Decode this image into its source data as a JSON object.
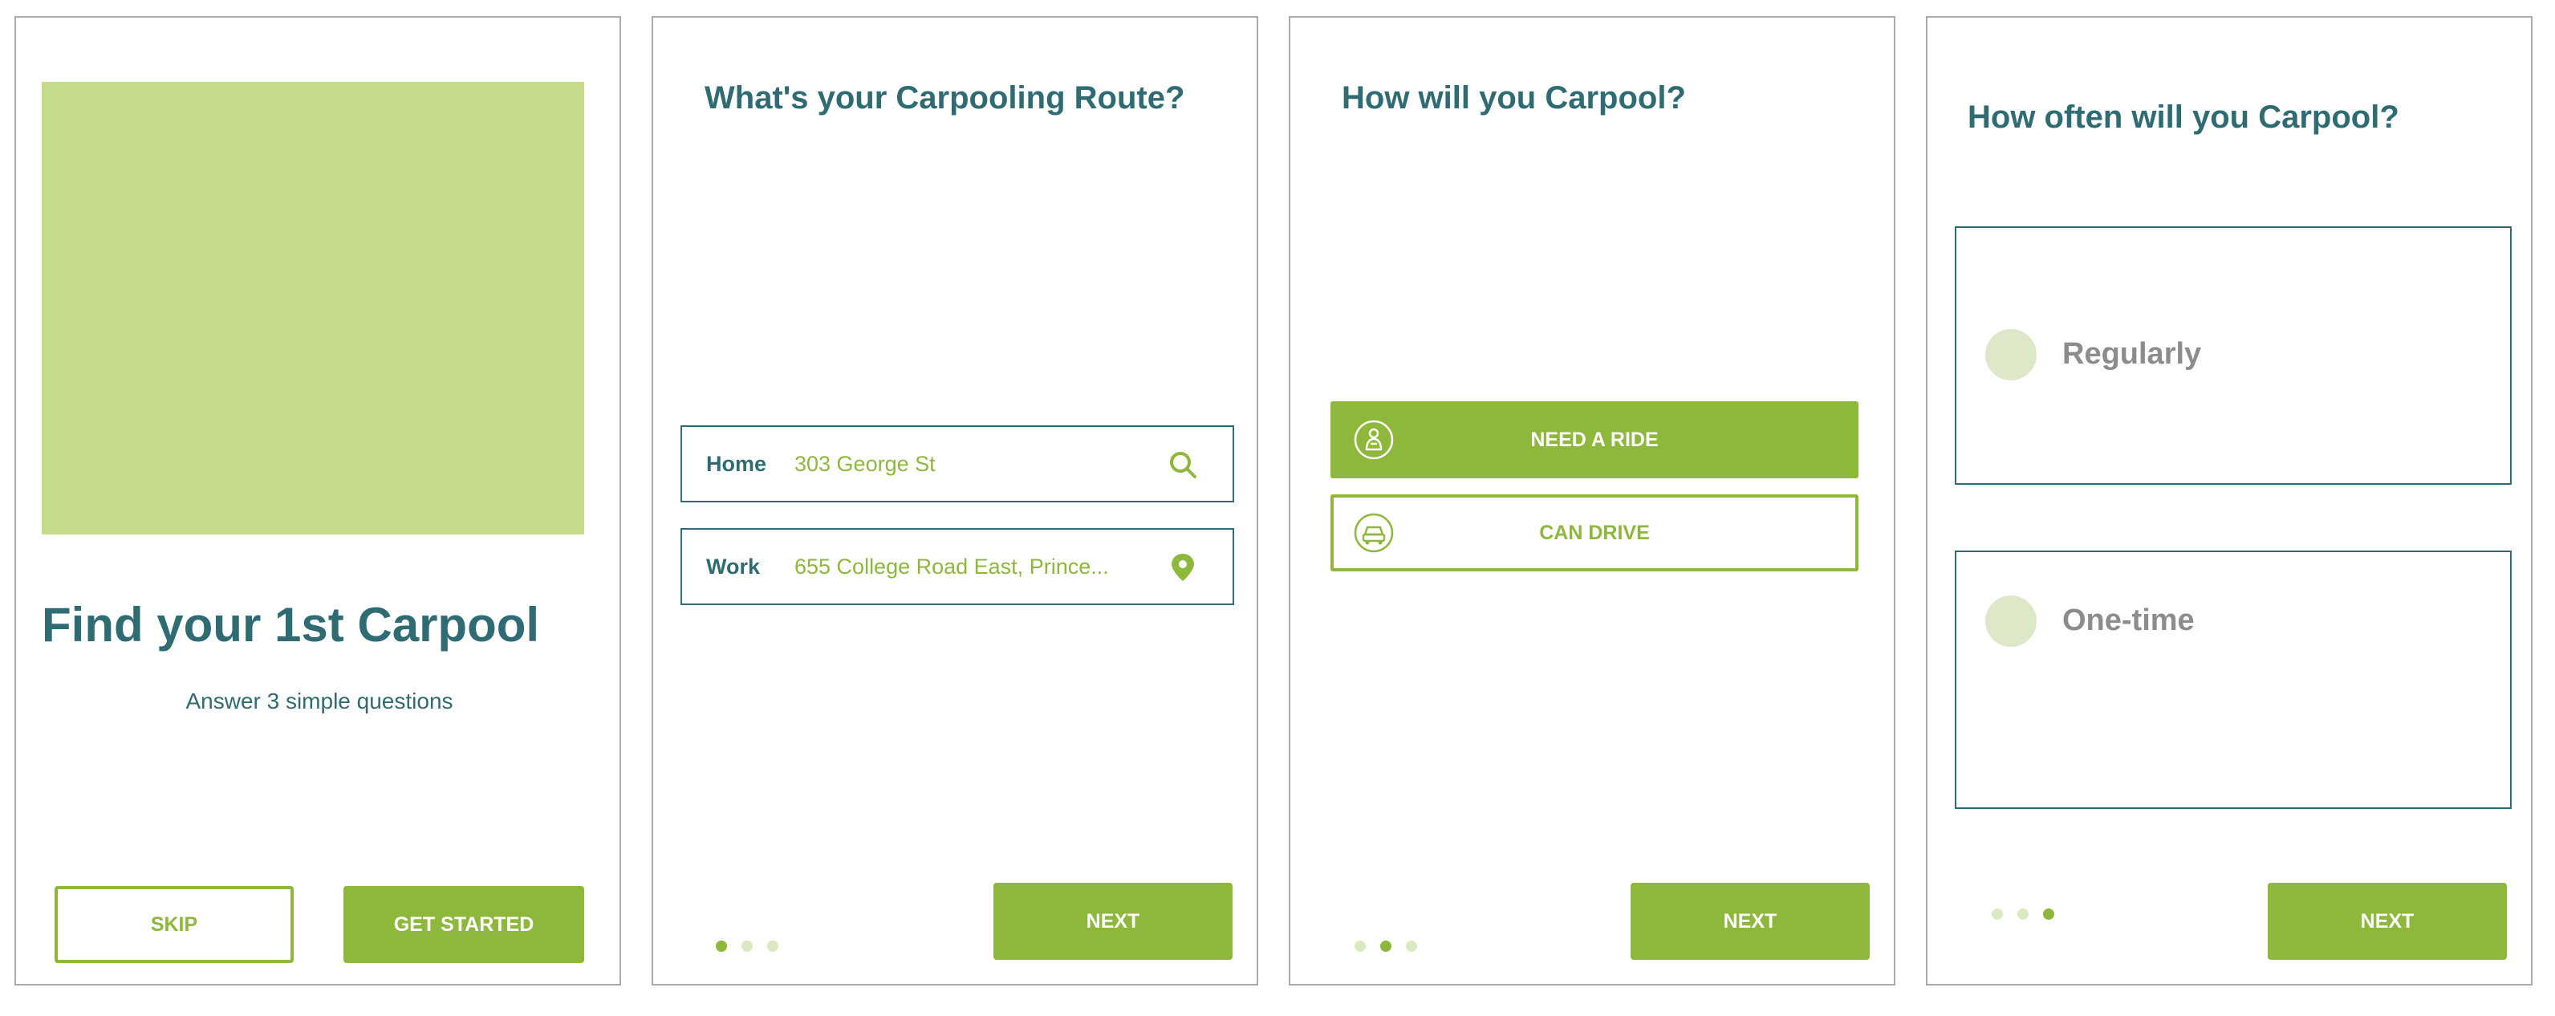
{
  "screen1": {
    "title": "Find your 1st Carpool",
    "subtitle": "Answer 3 simple questions",
    "skip_label": "SKIP",
    "get_started_label": "GET STARTED"
  },
  "screen2": {
    "title": "What's your Carpooling Route?",
    "home_label": "Home",
    "home_value": "303 George St",
    "work_label": "Work",
    "work_value": "655 College Road East, Prince...",
    "next_label": "NEXT",
    "active_step": 1
  },
  "screen3": {
    "title": "How will you Carpool?",
    "need_ride_label": "NEED A RIDE",
    "can_drive_label": "CAN DRIVE",
    "next_label": "NEXT",
    "active_step": 2
  },
  "screen4": {
    "title": "How often will you Carpool?",
    "option1_label": "Regularly",
    "option2_label": "One-time",
    "next_label": "NEXT",
    "active_step": 3
  },
  "colors": {
    "accent": "#8db83b",
    "teal": "#2f6b72",
    "hero": "#c5dc8b",
    "dot_inactive": "#dbe9c0",
    "radio": "#dde8c8",
    "muted_text": "#8c8c8c"
  },
  "icons": [
    "search-icon",
    "map-pin-icon",
    "passenger-icon",
    "car-icon"
  ]
}
